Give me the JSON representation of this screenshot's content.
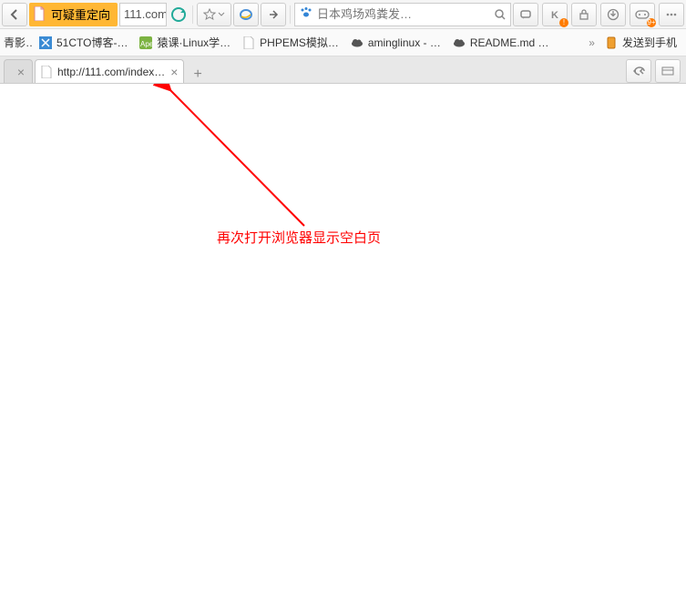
{
  "toolbar": {
    "warning_label": "可疑重定向",
    "address": "111.com",
    "search_placeholder": "日本鸡场鸡粪发…"
  },
  "bookmarks": {
    "left_trunc": "青影…",
    "items": [
      {
        "label": "51CTO博客-…"
      },
      {
        "label": "猿课·Linux学…"
      },
      {
        "label": "PHPEMS模拟…"
      },
      {
        "label": "aminglinux - …"
      },
      {
        "label": "README.md …"
      }
    ],
    "right_label": "发送到手机"
  },
  "tabs": {
    "items": [
      {
        "title": "",
        "blank": true
      },
      {
        "title": "http://111.com/index…",
        "active": true
      }
    ]
  },
  "annotation_text": "再次打开浏览器显示空白页"
}
